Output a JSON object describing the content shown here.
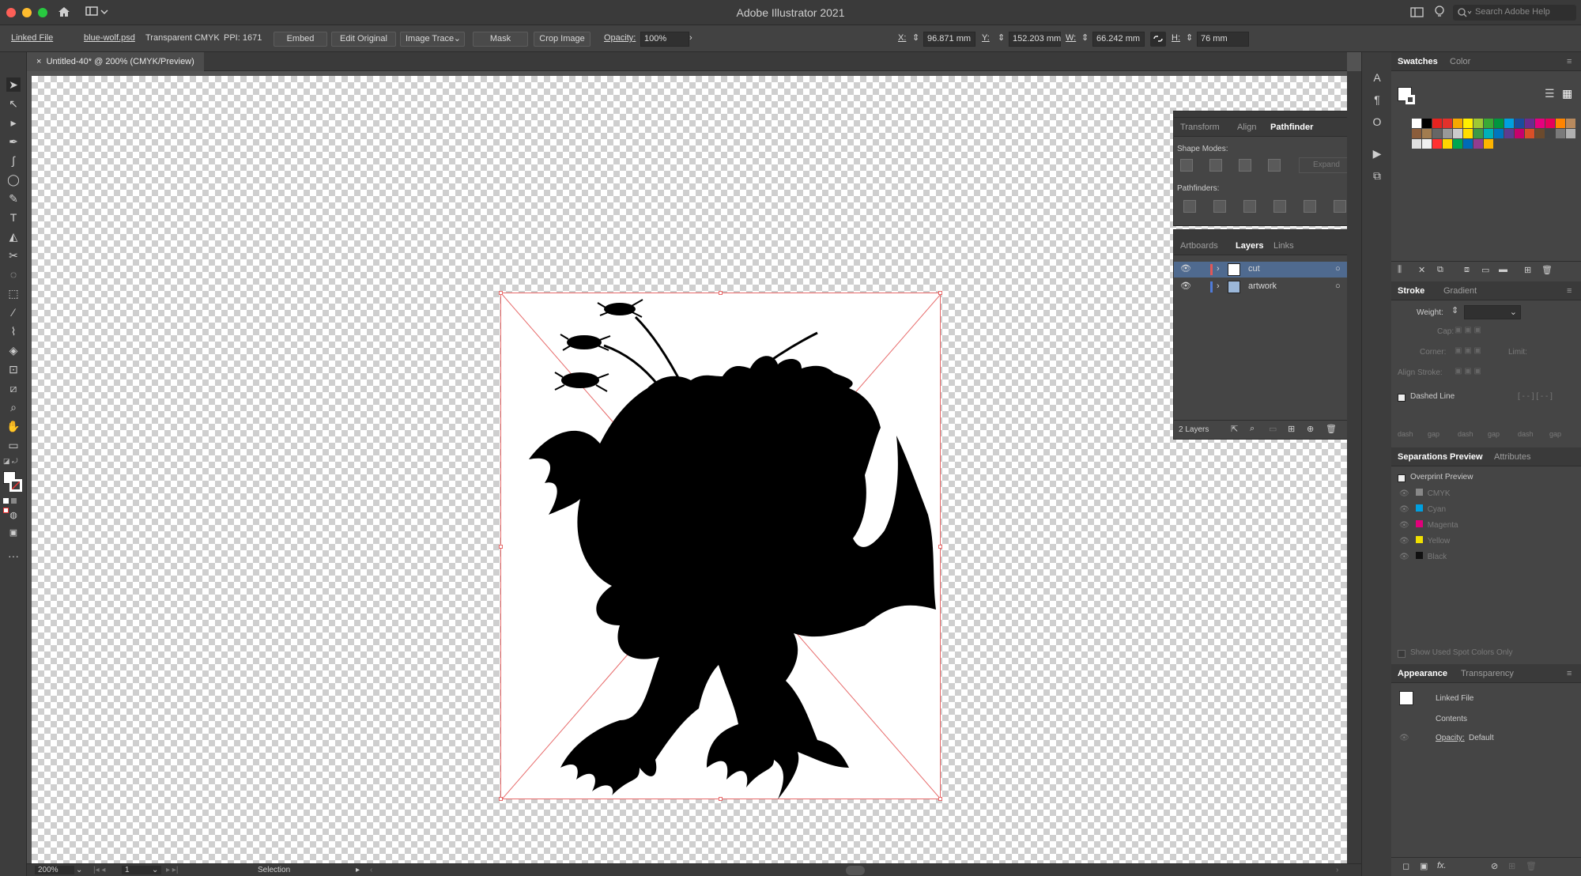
{
  "app": {
    "title": "Adobe Illustrator 2021",
    "search_placeholder": "Search Adobe Help"
  },
  "control": {
    "linked_file": "Linked File",
    "filename": "blue-wolf.psd",
    "colormode": "Transparent CMYK",
    "ppi": "PPI: 1671",
    "embed": "Embed",
    "edit_original": "Edit Original",
    "image_trace": "Image Trace",
    "mask": "Mask",
    "crop_image": "Crop Image",
    "opacity_label": "Opacity:",
    "opacity_value": "100%",
    "x_label": "X:",
    "x_value": "96.871 mm",
    "y_label": "Y:",
    "y_value": "152.203 mm",
    "w_label": "W:",
    "w_value": "66.242 mm",
    "h_label": "H:",
    "h_value": "76 mm"
  },
  "doc_tab": {
    "label": "Untitled-40* @ 200% (CMYK/Preview)"
  },
  "status": {
    "zoom": "200%",
    "page": "1",
    "tool": "Selection"
  },
  "pathfinder": {
    "tabs": [
      "Transform",
      "Align",
      "Pathfinder"
    ],
    "shape_modes": "Shape Modes:",
    "expand": "Expand",
    "pathfinders": "Pathfinders:"
  },
  "layers": {
    "tabs": [
      "Artboards",
      "Layers",
      "Links"
    ],
    "items": [
      {
        "name": "cut",
        "color": "#e35757"
      },
      {
        "name": "artwork",
        "color": "#4f7bd9"
      }
    ],
    "count": "2 Layers"
  },
  "swatches": {
    "tabs": [
      "Swatches",
      "Color"
    ]
  },
  "stroke": {
    "tabs": [
      "Stroke",
      "Gradient"
    ],
    "weight": "Weight:",
    "cap": "Cap:",
    "corner": "Corner:",
    "limit": "Limit:",
    "align_stroke": "Align Stroke:",
    "dashed_line": "Dashed Line",
    "dash_labels": [
      "dash",
      "gap",
      "dash",
      "gap",
      "dash",
      "gap"
    ]
  },
  "separations": {
    "tabs": [
      "Separations Preview",
      "Attributes"
    ],
    "overprint": "Overprint Preview",
    "inks": [
      {
        "name": "CMYK",
        "color": "#888888"
      },
      {
        "name": "Cyan",
        "color": "#00a0e0"
      },
      {
        "name": "Magenta",
        "color": "#e0007a"
      },
      {
        "name": "Yellow",
        "color": "#f0e000"
      },
      {
        "name": "Black",
        "color": "#111111"
      }
    ],
    "spot_only": "Show Used Spot Colors Only"
  },
  "appearance": {
    "tabs": [
      "Appearance",
      "Transparency"
    ],
    "linked_file": "Linked File",
    "contents": "Contents",
    "opacity_label": "Opacity:",
    "opacity_value": "Default"
  },
  "colors": {
    "accent": "#4f7bd9",
    "selection": "#e76a6a"
  }
}
